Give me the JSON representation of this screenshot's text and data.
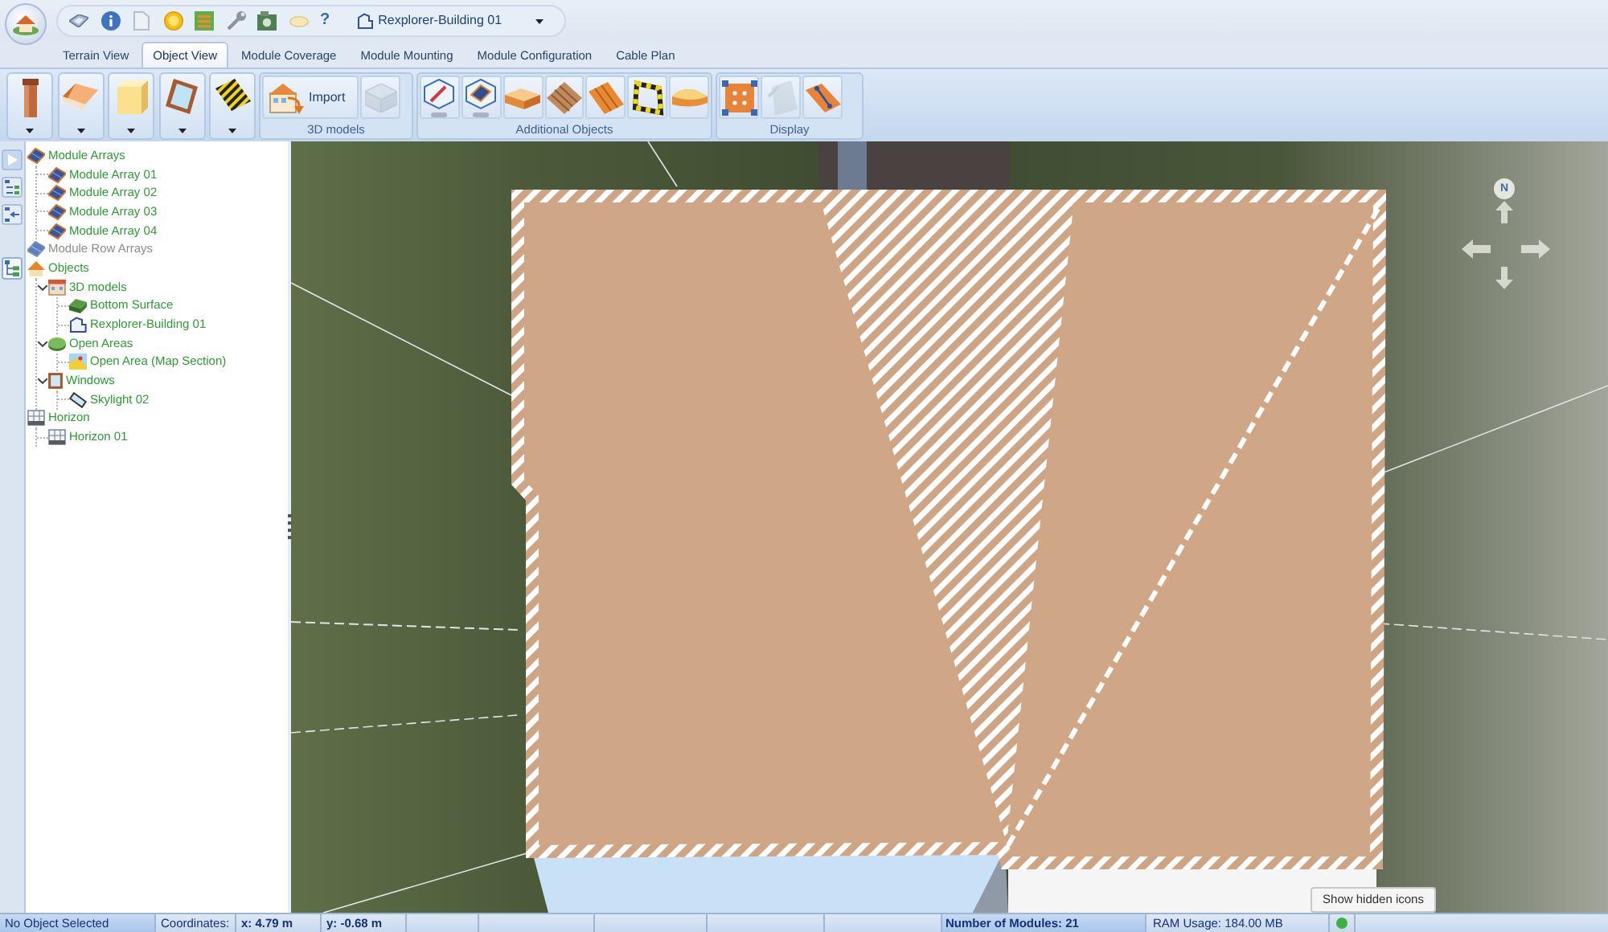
{
  "quick_access": {
    "help": "?"
  },
  "document_selector": {
    "value": "Rexplorer-Building 01"
  },
  "tabs": [
    {
      "label": "Terrain View",
      "selected": false
    },
    {
      "label": "Object View",
      "selected": true
    },
    {
      "label": "Module Coverage",
      "selected": false
    },
    {
      "label": "Module Mounting",
      "selected": false
    },
    {
      "label": "Module Configuration",
      "selected": false
    },
    {
      "label": "Cable Plan",
      "selected": false
    }
  ],
  "ribbon": {
    "groups": [
      {
        "buttons": [
          {
            "dropdown": true,
            "disabled": false
          },
          {
            "dropdown": true,
            "disabled": false
          },
          {
            "dropdown": true,
            "disabled": false
          },
          {
            "dropdown": true,
            "disabled": false
          },
          {
            "dropdown": true,
            "disabled": false
          }
        ]
      },
      {
        "label": "3D models",
        "buttons": [
          {
            "label": "Import",
            "disabled": false
          },
          {
            "disabled": true
          }
        ]
      },
      {
        "label": "Additional Objects",
        "buttons": [
          {
            "disabled": false
          },
          {
            "disabled": false
          },
          {
            "disabled": false
          },
          {
            "disabled": false
          },
          {
            "disabled": false
          },
          {
            "disabled": false
          },
          {
            "disabled": false
          }
        ]
      },
      {
        "label": "Display",
        "buttons": [
          {
            "disabled": false
          },
          {
            "disabled": true
          },
          {
            "disabled": false
          }
        ]
      }
    ]
  },
  "tree": [
    {
      "label": "Module Arrays",
      "kind": "module_array",
      "disabled": false,
      "children": [
        {
          "label": "Module Array 01",
          "kind": "module_array"
        },
        {
          "label": "Module Array 02",
          "kind": "module_array"
        },
        {
          "label": "Module Array 03",
          "kind": "module_array"
        },
        {
          "label": "Module Array 04",
          "kind": "module_array"
        }
      ]
    },
    {
      "label": "Module Row Arrays",
      "kind": "module_row_array",
      "disabled": true
    },
    {
      "label": "Objects",
      "kind": "objects",
      "disabled": false,
      "children": [
        {
          "label": "3D models",
          "kind": "models",
          "expanded": true,
          "children": [
            {
              "label": "Bottom Surface",
              "kind": "surface"
            },
            {
              "label": "Rexplorer-Building 01",
              "kind": "building"
            }
          ]
        },
        {
          "label": "Open Areas",
          "kind": "open_area",
          "expanded": true,
          "children": [
            {
              "label": "Open Area (Map Section)",
              "kind": "map_area"
            }
          ]
        },
        {
          "label": "Windows",
          "kind": "window",
          "expanded": true,
          "children": [
            {
              "label": "Skylight 02",
              "kind": "skylight"
            }
          ]
        }
      ]
    },
    {
      "label": "Horizon",
      "kind": "horizon",
      "disabled": false,
      "children": [
        {
          "label": "Horizon 01",
          "kind": "horizon"
        }
      ]
    }
  ],
  "viewport": {
    "compass": {
      "north": "N"
    }
  },
  "tooltip": "Show hidden icons",
  "status_bar": {
    "selection": "No Object Selected",
    "coordinates_label": "Coordinates:",
    "x": "x: 4.79 m",
    "y": "y: -0.68 m",
    "module_count": "Number of Modules: 21",
    "ram_usage": "RAM Usage: 184.00 MB"
  }
}
